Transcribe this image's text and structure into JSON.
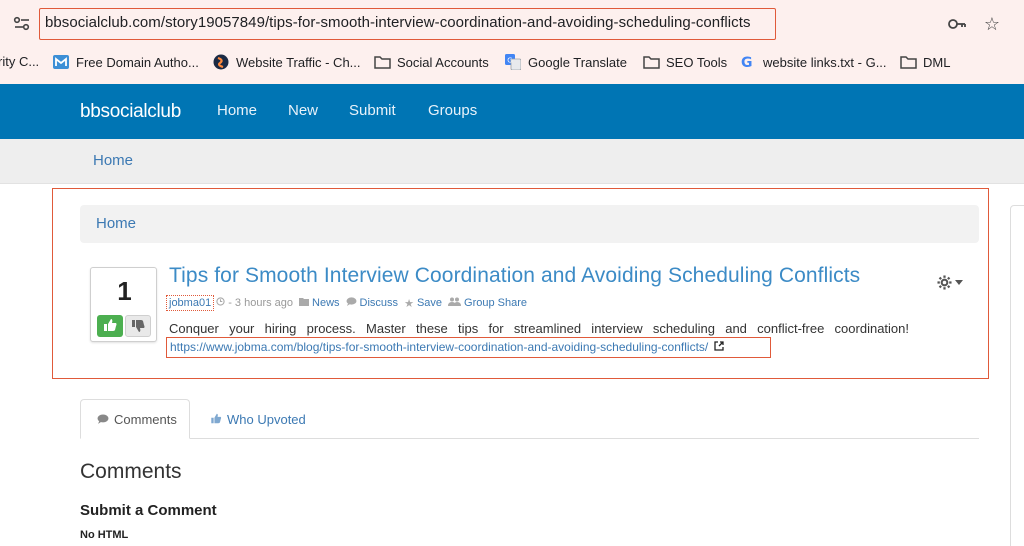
{
  "browser": {
    "url": "bbsocialclub.com/story19057849/tips-for-smooth-interview-coordination-and-avoiding-scheduling-conflicts",
    "bookmarks": [
      {
        "label": "rity C...",
        "icon": "none"
      },
      {
        "label": "Free Domain Autho...",
        "icon": "m-logo-icon"
      },
      {
        "label": "Website Traffic - Ch...",
        "icon": "similarweb-icon"
      },
      {
        "label": "Social Accounts",
        "icon": "folder-icon"
      },
      {
        "label": "Google Translate",
        "icon": "translate-icon"
      },
      {
        "label": "SEO Tools",
        "icon": "folder-icon"
      },
      {
        "label": "website links.txt - G...",
        "icon": "google-icon"
      },
      {
        "label": "DML",
        "icon": "folder-icon"
      }
    ]
  },
  "navbar": {
    "brand": "bbsocialclub",
    "links": [
      "Home",
      "New",
      "Submit",
      "Groups"
    ]
  },
  "breadcrumb": {
    "top": "Home",
    "inner": "Home"
  },
  "story": {
    "votes": "1",
    "title": "Tips for Smooth Interview Coordination and Avoiding Scheduling Conflicts",
    "user": "jobma01",
    "time": "- 3 hours ago",
    "category": "News",
    "discuss": "Discuss",
    "save": "Save",
    "group_share": "Group Share",
    "description": "Conquer your hiring process. Master these tips for streamlined interview scheduling and conflict-free coordination!",
    "link": "https://www.jobma.com/blog/tips-for-smooth-interview-coordination-and-avoiding-scheduling-conflicts/"
  },
  "tabs": {
    "comments": "Comments",
    "who_upvoted": "Who Upvoted"
  },
  "comments": {
    "heading": "Comments",
    "submit_heading": "Submit a Comment",
    "no_html": "No HTML"
  },
  "colors": {
    "navbar": "#0075b4",
    "link": "#3c79b3",
    "title": "#3c8bc6",
    "highlight": "#e05a3a",
    "upvote": "#4caf50"
  }
}
